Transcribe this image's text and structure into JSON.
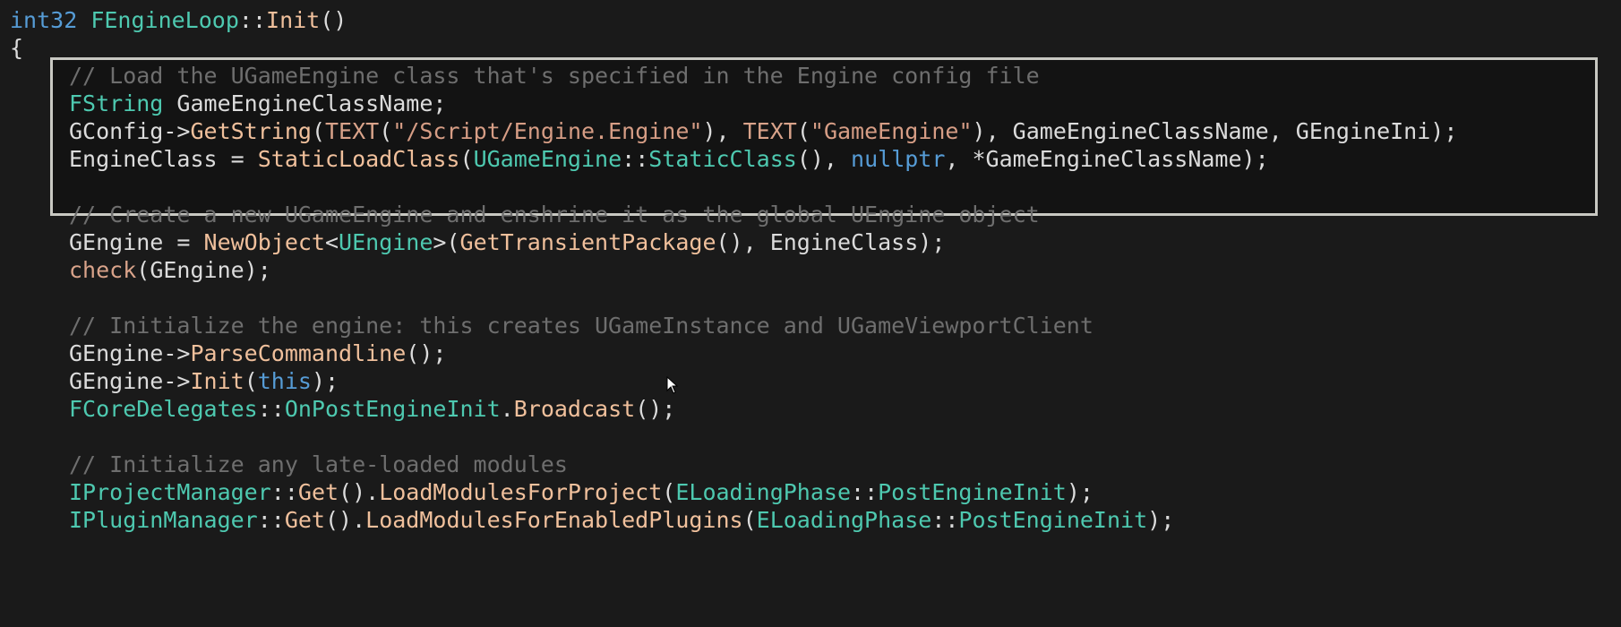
{
  "editor": {
    "lines": [
      {
        "indent": 0,
        "tokens": [
          {
            "t": "int32",
            "k": "kw"
          },
          {
            "t": " ",
            "k": "punct"
          },
          {
            "t": "FEngineLoop",
            "k": "type"
          },
          {
            "t": "::",
            "k": "punct"
          },
          {
            "t": "Init",
            "k": "func"
          },
          {
            "t": "()",
            "k": "punct"
          }
        ]
      },
      {
        "indent": 0,
        "tokens": [
          {
            "t": "{",
            "k": "punct"
          }
        ]
      },
      {
        "indent": 1,
        "tokens": [
          {
            "t": "// Load the UGameEngine class that's specified in the Engine config file",
            "k": "comment"
          }
        ]
      },
      {
        "indent": 1,
        "tokens": [
          {
            "t": "FString",
            "k": "type"
          },
          {
            "t": " GameEngineClassName;",
            "k": "ident"
          }
        ]
      },
      {
        "indent": 1,
        "tokens": [
          {
            "t": "GConfig->",
            "k": "ident"
          },
          {
            "t": "GetString",
            "k": "func"
          },
          {
            "t": "(",
            "k": "punct"
          },
          {
            "t": "TEXT",
            "k": "macro"
          },
          {
            "t": "(",
            "k": "punct"
          },
          {
            "t": "\"/Script/Engine.Engine\"",
            "k": "str"
          },
          {
            "t": "), ",
            "k": "punct"
          },
          {
            "t": "TEXT",
            "k": "macro"
          },
          {
            "t": "(",
            "k": "punct"
          },
          {
            "t": "\"GameEngine\"",
            "k": "str"
          },
          {
            "t": "), GameEngineClassName, GEngineIni);",
            "k": "ident"
          }
        ]
      },
      {
        "indent": 1,
        "tokens": [
          {
            "t": "EngineClass = ",
            "k": "ident"
          },
          {
            "t": "StaticLoadClass",
            "k": "func"
          },
          {
            "t": "(",
            "k": "punct"
          },
          {
            "t": "UGameEngine",
            "k": "type"
          },
          {
            "t": "::",
            "k": "punct"
          },
          {
            "t": "StaticClass",
            "k": "type"
          },
          {
            "t": "(), ",
            "k": "punct"
          },
          {
            "t": "nullptr",
            "k": "kw"
          },
          {
            "t": ", *GameEngineClassName);",
            "k": "ident"
          }
        ]
      },
      {
        "indent": 1,
        "tokens": []
      },
      {
        "indent": 1,
        "tokens": [
          {
            "t": "// Create a new UGameEngine and enshrine it as the global UEngine object",
            "k": "comment"
          }
        ]
      },
      {
        "indent": 1,
        "tokens": [
          {
            "t": "GEngine = ",
            "k": "ident"
          },
          {
            "t": "NewObject",
            "k": "func"
          },
          {
            "t": "<",
            "k": "punct"
          },
          {
            "t": "UEngine",
            "k": "type"
          },
          {
            "t": ">(",
            "k": "punct"
          },
          {
            "t": "GetTransientPackage",
            "k": "func"
          },
          {
            "t": "(), EngineClass);",
            "k": "ident"
          }
        ]
      },
      {
        "indent": 1,
        "tokens": [
          {
            "t": "check",
            "k": "macro"
          },
          {
            "t": "(GEngine);",
            "k": "ident"
          }
        ]
      },
      {
        "indent": 1,
        "tokens": []
      },
      {
        "indent": 1,
        "tokens": [
          {
            "t": "// Initialize the engine: this creates UGameInstance and UGameViewportClient",
            "k": "comment"
          }
        ]
      },
      {
        "indent": 1,
        "tokens": [
          {
            "t": "GEngine->",
            "k": "ident"
          },
          {
            "t": "ParseCommandline",
            "k": "func"
          },
          {
            "t": "();",
            "k": "punct"
          }
        ]
      },
      {
        "indent": 1,
        "tokens": [
          {
            "t": "GEngine->",
            "k": "ident"
          },
          {
            "t": "Init",
            "k": "func"
          },
          {
            "t": "(",
            "k": "punct"
          },
          {
            "t": "this",
            "k": "kw"
          },
          {
            "t": ");",
            "k": "punct"
          }
        ]
      },
      {
        "indent": 1,
        "tokens": [
          {
            "t": "FCoreDelegates",
            "k": "type"
          },
          {
            "t": "::",
            "k": "punct"
          },
          {
            "t": "OnPostEngineInit",
            "k": "type"
          },
          {
            "t": ".",
            "k": "punct"
          },
          {
            "t": "Broadcast",
            "k": "func"
          },
          {
            "t": "();",
            "k": "punct"
          }
        ]
      },
      {
        "indent": 1,
        "tokens": []
      },
      {
        "indent": 1,
        "tokens": [
          {
            "t": "// Initialize any late-loaded modules",
            "k": "comment"
          }
        ]
      },
      {
        "indent": 1,
        "tokens": [
          {
            "t": "IProjectManager",
            "k": "type"
          },
          {
            "t": "::",
            "k": "punct"
          },
          {
            "t": "Get",
            "k": "func"
          },
          {
            "t": "().",
            "k": "punct"
          },
          {
            "t": "LoadModulesForProject",
            "k": "func"
          },
          {
            "t": "(",
            "k": "punct"
          },
          {
            "t": "ELoadingPhase",
            "k": "type"
          },
          {
            "t": "::",
            "k": "punct"
          },
          {
            "t": "PostEngineInit",
            "k": "type"
          },
          {
            "t": ");",
            "k": "punct"
          }
        ]
      },
      {
        "indent": 1,
        "tokens": [
          {
            "t": "IPluginManager",
            "k": "type"
          },
          {
            "t": "::",
            "k": "punct"
          },
          {
            "t": "Get",
            "k": "func"
          },
          {
            "t": "().",
            "k": "punct"
          },
          {
            "t": "LoadModulesForEnabledPlugins",
            "k": "func"
          },
          {
            "t": "(",
            "k": "punct"
          },
          {
            "t": "ELoadingPhase",
            "k": "type"
          },
          {
            "t": "::",
            "k": "punct"
          },
          {
            "t": "PostEngineInit",
            "k": "type"
          },
          {
            "t": ");",
            "k": "punct"
          }
        ]
      }
    ]
  },
  "theme": {
    "background": "#1a1a1a",
    "keyword": "#569cd6",
    "type": "#4ec9b0",
    "function": "#f0c09c",
    "string": "#d69d85",
    "comment": "#6e6e6e",
    "text": "#dcdcdc",
    "highlight_border": "#c8c8c2"
  },
  "cursor": {
    "icon": "mouse-pointer-icon"
  }
}
